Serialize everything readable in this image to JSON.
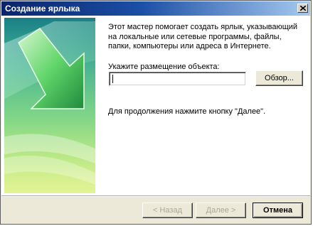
{
  "window": {
    "title": "Создание ярлыка"
  },
  "intro_text": "Этот мастер помогает создать ярлык, указывающий на локальные или сетевые программы, файлы, папки, компьютеры или адреса в Интернете.",
  "location": {
    "label": "Укажите размещение объекта:",
    "value": "",
    "browse_label": "Обзор..."
  },
  "continue_text": "Для продолжения нажмите кнопку \"Далее\".",
  "footer": {
    "back_label": "< Назад",
    "next_label": "Далее >",
    "cancel_label": "Отмена",
    "back_enabled": false,
    "next_enabled": false
  },
  "colors": {
    "title_bar_start": "#0a246a",
    "title_bar_end": "#a6caf0",
    "dialog_face": "#ece9d8",
    "panel_green": "#3cc08a"
  },
  "icons": {
    "close": "close-icon",
    "side_graphic": "green-arrow-graphic"
  }
}
